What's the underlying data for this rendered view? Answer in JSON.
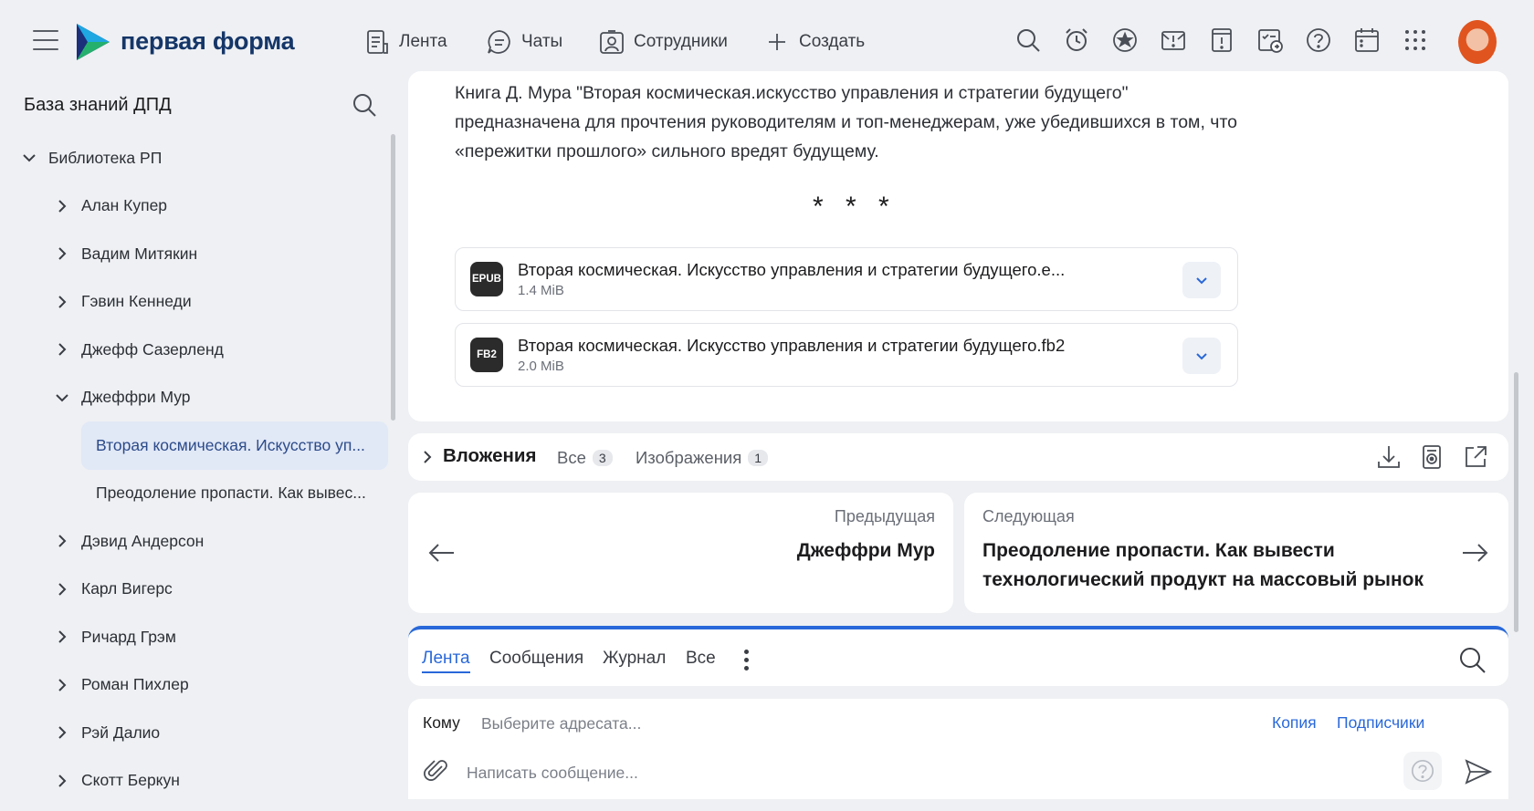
{
  "app": {
    "brand": "первая форма",
    "nav": [
      {
        "label": "Лента",
        "icon": "feed-icon"
      },
      {
        "label": "Чаты",
        "icon": "chat-icon"
      },
      {
        "label": "Сотрудники",
        "icon": "employees-icon"
      },
      {
        "label": "Создать",
        "icon": "plus-icon"
      }
    ],
    "top_icons": [
      "search-icon",
      "alarm-clock-icon",
      "star-icon",
      "mail-alert-icon",
      "notice-icon",
      "tasks-icon",
      "help-icon",
      "calendar-icon",
      "apps-grid-icon"
    ]
  },
  "sidebar": {
    "title": "База знаний ДПД",
    "tree": [
      {
        "label": "Библиотека РП",
        "level": 0,
        "expanded": true
      },
      {
        "label": "Алан Купер",
        "level": 1,
        "expanded": false
      },
      {
        "label": "Вадим Митякин",
        "level": 1,
        "expanded": false
      },
      {
        "label": "Гэвин Кеннеди",
        "level": 1,
        "expanded": false
      },
      {
        "label": "Джефф Сазерленд",
        "level": 1,
        "expanded": false
      },
      {
        "label": "Джеффри Мур",
        "level": 1,
        "expanded": true
      },
      {
        "label": "Вторая космическая. Искусство уп...",
        "level": 2,
        "selected": true
      },
      {
        "label": "Преодоление пропасти. Как вывес...",
        "level": 2
      },
      {
        "label": "Дэвид Андерсон",
        "level": 1,
        "expanded": false
      },
      {
        "label": "Карл Вигерс",
        "level": 1,
        "expanded": false
      },
      {
        "label": "Ричард Грэм",
        "level": 1,
        "expanded": false
      },
      {
        "label": "Роман Пихлер",
        "level": 1,
        "expanded": false
      },
      {
        "label": "Рэй Далио",
        "level": 1,
        "expanded": false
      },
      {
        "label": "Скотт Беркун",
        "level": 1,
        "expanded": false
      }
    ]
  },
  "content": {
    "description": "Книга Д. Мура \"Вторая космическая.искусство управления и стратегии будущего\" предназначена для прочтения руководителям и топ-менеджерам, уже убедившихся в том, что «пережитки прошлого» сильного вредят будущему.",
    "separator": "* * *",
    "files": [
      {
        "badge": "EPUB",
        "name": "Вторая космическая. Искусство управления и стратегии будущего.e...",
        "size": "1.4 MiB"
      },
      {
        "badge": "FB2",
        "name": "Вторая космическая. Искусство управления и стратегии будущего.fb2",
        "size": "2.0 MiB"
      }
    ]
  },
  "attachments": {
    "title": "Вложения",
    "tabs": [
      {
        "label": "Все",
        "count": "3"
      },
      {
        "label": "Изображения",
        "count": "1"
      }
    ]
  },
  "pager": {
    "prev_label": "Предыдущая",
    "prev_title": "Джеффри Мур",
    "next_label": "Следующая",
    "next_title": "Преодоление пропасти. Как вывести технологический продукт на массовый рынок"
  },
  "feed": {
    "tabs": [
      "Лента",
      "Сообщения",
      "Журнал",
      "Все"
    ],
    "active_tab": "Лента"
  },
  "composer": {
    "to_label": "Кому",
    "to_placeholder": "Выберите адресата...",
    "copy_label": "Копия",
    "subscribers_label": "Подписчики",
    "message_placeholder": "Написать сообщение..."
  },
  "colors": {
    "accent": "#2968d9",
    "brand": "#153668",
    "selected_bg": "#e1e8f6"
  }
}
